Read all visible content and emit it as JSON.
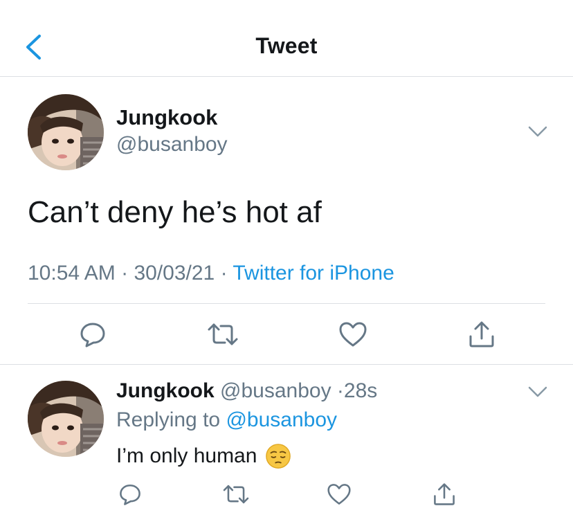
{
  "header": {
    "title": "Tweet"
  },
  "tweet": {
    "author_name": "Jungkook",
    "author_handle": "@busanboy",
    "text": "Can’t deny he’s hot af",
    "time": "10:54 AM",
    "date": "30/03/21",
    "source": "Twitter for iPhone",
    "separator": "·"
  },
  "reply": {
    "author_name": "Jungkook",
    "author_handle": "@busanboy",
    "age": "28s",
    "replying_prefix": "Replying to",
    "replying_to": "@busanboy",
    "text": "I’m only human",
    "emoji": "pensive-face"
  },
  "icons": {
    "back": "chevron-left-icon",
    "more": "chevron-down-icon",
    "reply": "comment-icon",
    "retweet": "retweet-icon",
    "like": "heart-icon",
    "share": "share-icon"
  },
  "colors": {
    "accent": "#1b95e0",
    "secondary_text": "#657786",
    "primary_text": "#14171a",
    "divider": "#dcdfe3"
  }
}
